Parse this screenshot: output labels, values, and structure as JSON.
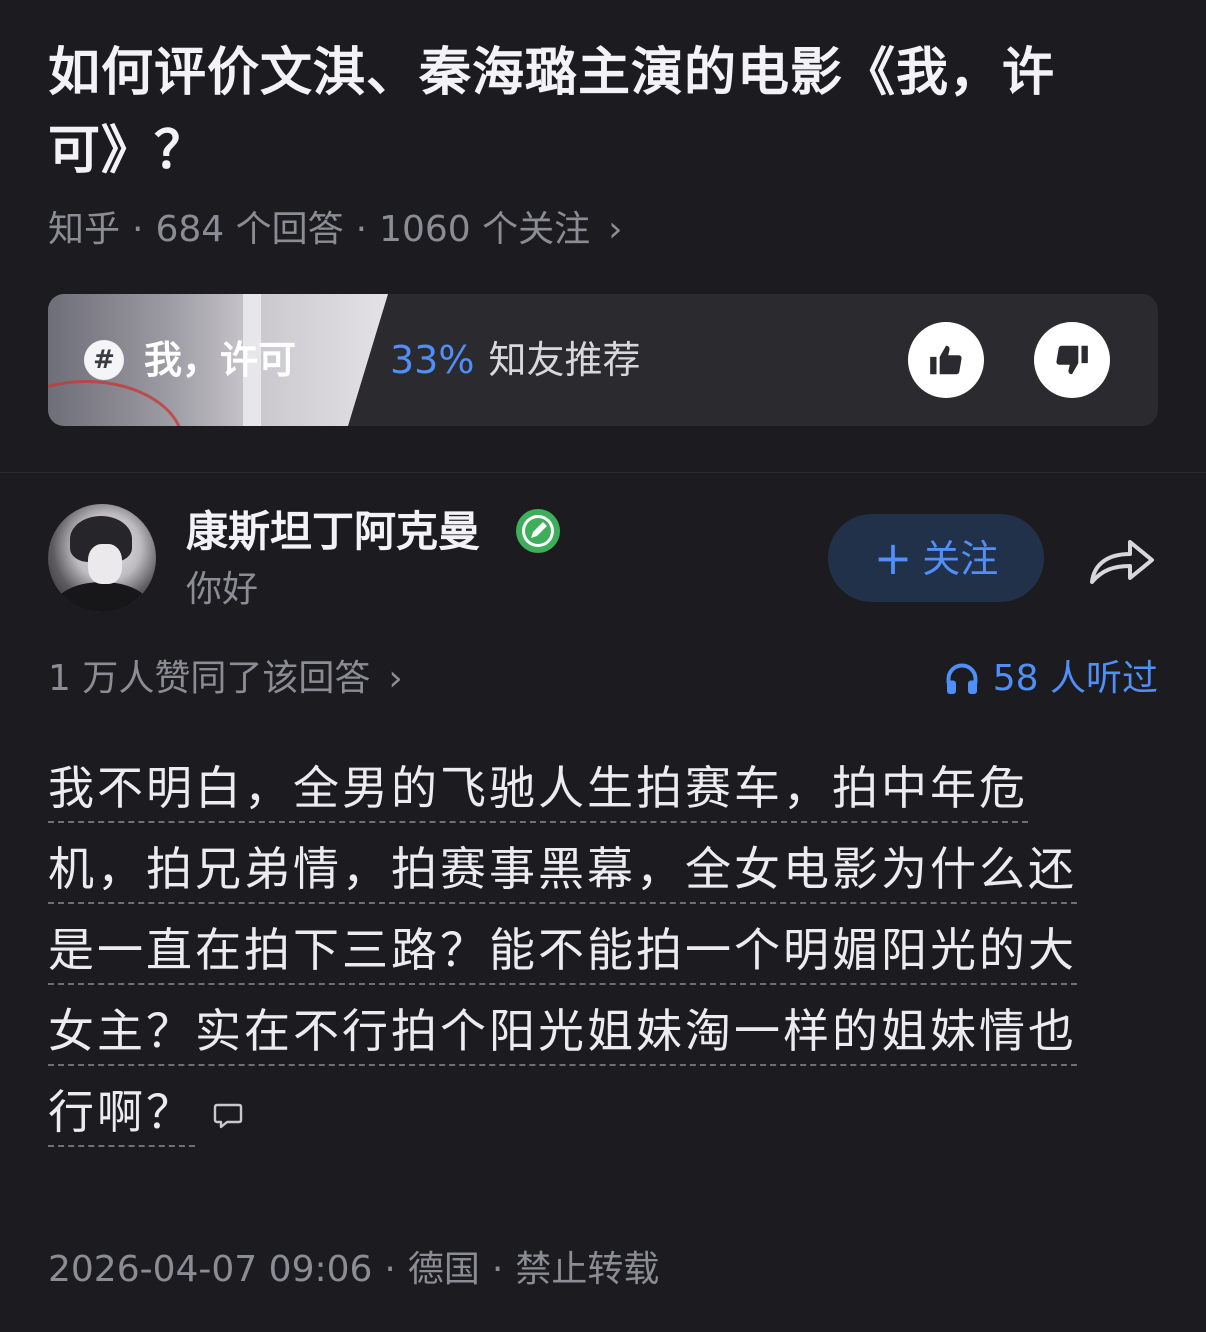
{
  "question": {
    "title": "如何评价文淇、秦海璐主演的电影《我，许可》？",
    "source": "知乎",
    "answers_count": "684 个回答",
    "followers_count": "1060 个关注",
    "chevron": "›"
  },
  "movie_card": {
    "hash_symbol": "#",
    "movie_name": "我，许可",
    "recommend_percent": "33%",
    "recommend_label": "知友推荐"
  },
  "author": {
    "name": "康斯坦丁阿克曼",
    "bio": "你好",
    "follow_plus": "+",
    "follow_label": "关注"
  },
  "stats": {
    "upvotes": "1 万人赞同了该回答",
    "chevron": "›",
    "listeners": "58 人听过"
  },
  "answer": {
    "lines": [
      "我不明白，全男的飞驰人生拍赛车，拍中年危",
      "机，拍兄弟情，拍赛事黑幕，全女电影为什么还",
      "是一直在拍下三路？能不能拍一个明媚阳光的大",
      "女主？实在不行拍个阳光姐妹淘一样的姐妹情也",
      "行啊？"
    ]
  },
  "footer": {
    "datetime": "2026-04-07 09:06",
    "location": "德国",
    "copyright": "禁止转载",
    "separator": "·"
  },
  "colors": {
    "background": "#1c1c20",
    "accent_blue": "#4f8ff7",
    "verify_green": "#3fae5a",
    "muted_text": "#8c8c94"
  },
  "icons": {
    "like": "thumbs-up-icon",
    "dislike": "thumbs-down-icon",
    "share": "share-arrow-icon",
    "listen": "headphones-icon",
    "comment": "comment-bubble-icon",
    "verify": "verified-badge-icon"
  }
}
